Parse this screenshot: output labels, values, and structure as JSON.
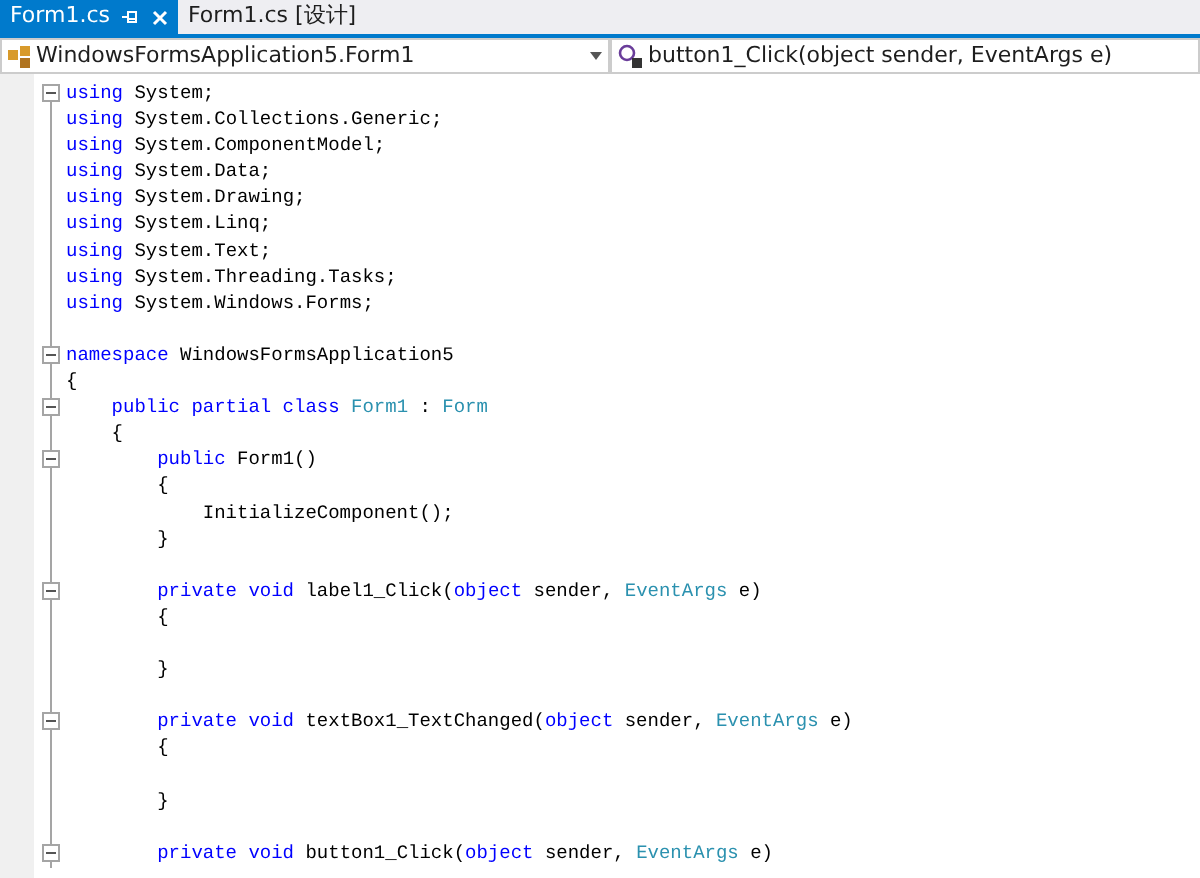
{
  "tabs": [
    {
      "label": "Form1.cs",
      "selected": true
    },
    {
      "label": "Form1.cs [设计]",
      "selected": false
    }
  ],
  "navigation": {
    "type_dropdown": "WindowsFormsApplication5.Form1",
    "member_dropdown": "button1_Click(object sender, EventArgs e)"
  },
  "code": [
    {
      "kind": "code",
      "expanded": true,
      "tokens": [
        {
          "kind": "keyword",
          "text": "using"
        },
        {
          "kind": "plain",
          "text": " System;"
        }
      ]
    },
    {
      "kind": "code",
      "tokens": [
        {
          "kind": "keyword",
          "text": "using"
        },
        {
          "kind": "plain",
          "text": " System.Collections.Generic;"
        }
      ]
    },
    {
      "kind": "code",
      "tokens": [
        {
          "kind": "keyword",
          "text": "using"
        },
        {
          "kind": "plain",
          "text": " System.ComponentModel;"
        }
      ]
    },
    {
      "kind": "code",
      "tokens": [
        {
          "kind": "keyword",
          "text": "using"
        },
        {
          "kind": "plain",
          "text": " System.Data;"
        }
      ]
    },
    {
      "kind": "code",
      "tokens": [
        {
          "kind": "keyword",
          "text": "using"
        },
        {
          "kind": "plain",
          "text": " System.Drawing;"
        }
      ]
    },
    {
      "kind": "code",
      "tokens": [
        {
          "kind": "keyword",
          "text": "using"
        },
        {
          "kind": "plain",
          "text": " System.Linq;"
        }
      ]
    },
    {
      "kind": "code",
      "tokens": [
        {
          "kind": "keyword",
          "text": "using"
        },
        {
          "kind": "plain",
          "text": " System.Text;"
        }
      ]
    },
    {
      "kind": "code",
      "tokens": [
        {
          "kind": "keyword",
          "text": "using"
        },
        {
          "kind": "plain",
          "text": " System.Threading.Tasks;"
        }
      ]
    },
    {
      "kind": "code",
      "tokens": [
        {
          "kind": "keyword",
          "text": "using"
        },
        {
          "kind": "plain",
          "text": " System.Windows.Forms;"
        }
      ]
    },
    {
      "kind": "blank"
    },
    {
      "kind": "code",
      "expanded": true,
      "tokens": [
        {
          "kind": "keyword",
          "text": "namespace"
        },
        {
          "kind": "plain",
          "text": " WindowsFormsApplication5"
        }
      ],
      "open": "{",
      "children": [
        {
          "kind": "code",
          "expanded": true,
          "tokens": [
            {
              "kind": "keyword",
              "text": "public partial class"
            },
            {
              "kind": "type",
              "text": " Form1"
            },
            {
              "kind": "plain",
              "text": " : "
            },
            {
              "kind": "type",
              "text": "Form"
            }
          ],
          "open": "{",
          "children": [
            {
              "kind": "code",
              "expanded": true,
              "tokens": [
                {
                  "kind": "keyword",
                  "text": "public"
                },
                {
                  "kind": "plain",
                  "text": " Form1()"
                }
              ],
              "open": "{",
              "children": [
                {
                  "kind": "code",
                  "tokens": [
                    {
                      "kind": "plain",
                      "text": "InitializeComponent();"
                    }
                  ]
                }
              ],
              "close": "}"
            },
            {
              "kind": "blank"
            },
            {
              "kind": "code",
              "expanded": true,
              "tokens": [
                {
                  "kind": "keyword",
                  "text": "private void"
                },
                {
                  "kind": "plain",
                  "text": " label1_Click("
                },
                {
                  "kind": "keyword",
                  "text": "object"
                },
                {
                  "kind": "plain",
                  "text": " sender, "
                },
                {
                  "kind": "type",
                  "text": "EventArgs"
                },
                {
                  "kind": "plain",
                  "text": " e)"
                }
              ],
              "open": "{",
              "children": [
                {
                  "kind": "blank"
                }
              ],
              "close": "}"
            },
            {
              "kind": "blank"
            },
            {
              "kind": "code",
              "expanded": true,
              "tokens": [
                {
                  "kind": "keyword",
                  "text": "private void"
                },
                {
                  "kind": "plain",
                  "text": " textBox1_TextChanged("
                },
                {
                  "kind": "keyword",
                  "text": "object"
                },
                {
                  "kind": "plain",
                  "text": " sender, "
                },
                {
                  "kind": "type",
                  "text": "EventArgs"
                },
                {
                  "kind": "plain",
                  "text": " e)"
                }
              ],
              "open": "{",
              "children": [
                {
                  "kind": "blank"
                }
              ],
              "close": "}"
            },
            {
              "kind": "blank"
            },
            {
              "kind": "code",
              "expanded": true,
              "tokens": [
                {
                  "kind": "keyword",
                  "text": "private void"
                },
                {
                  "kind": "plain",
                  "text": " button1_Click("
                },
                {
                  "kind": "keyword",
                  "text": "object"
                },
                {
                  "kind": "plain",
                  "text": " sender, "
                },
                {
                  "kind": "type",
                  "text": "EventArgs"
                },
                {
                  "kind": "plain",
                  "text": " e)"
                }
              ]
            }
          ]
        }
      ]
    }
  ]
}
